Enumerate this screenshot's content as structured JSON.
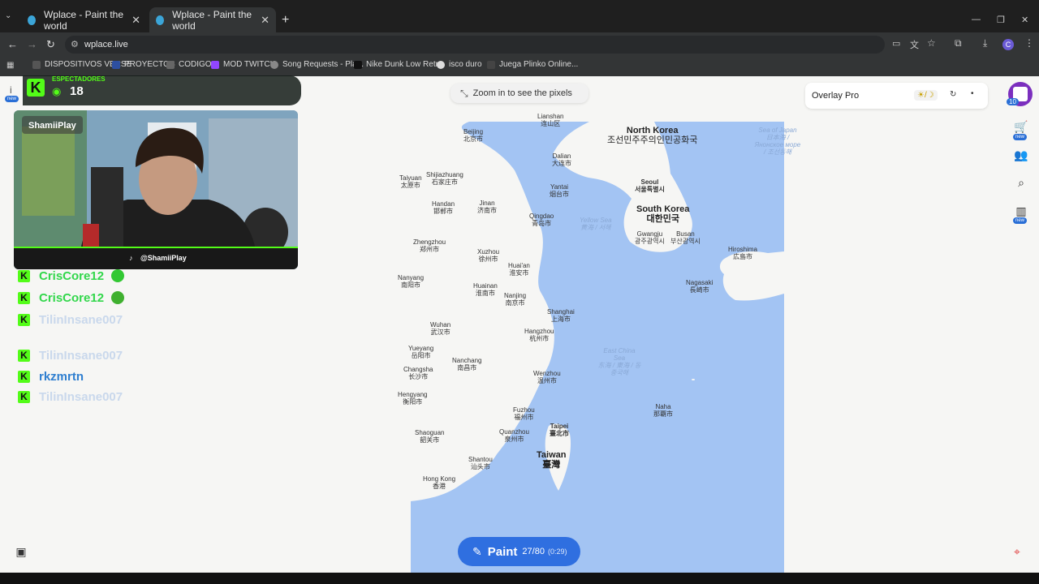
{
  "browser": {
    "tabs": [
      {
        "title": "Wplace - Paint the world"
      },
      {
        "title": "Wplace - Paint the world"
      }
    ],
    "new_tab": "+",
    "url": "wplace.live",
    "window_controls": {
      "minimize": "—",
      "maximize": "❐",
      "close": "✕"
    },
    "bookmarks": [
      "DISPOSITIVOS VERSE",
      "PROYECTOS",
      "CODIGO",
      "MOD TWITCH",
      "Song Requests - Pla...",
      "Nike Dunk Low Retr...",
      "isco duro",
      "Juega Plinko Online..."
    ]
  },
  "stream": {
    "viewers_label": "ESPECTADORES",
    "viewers_count": "18",
    "streamer_name": "ShamiiPlay",
    "tiktok_handle": "@ShamiiPlay",
    "chat": [
      {
        "name": "CrisCore12",
        "color": "#32d74b",
        "emote": true
      },
      {
        "name": "CrisCore12",
        "color": "#32d74b",
        "emote": true
      },
      {
        "name": "TilinInsane007",
        "color": "#c9d8ec",
        "emote": false
      },
      {
        "name": "TilinInsane007",
        "color": "#c9d8ec",
        "emote": false
      },
      {
        "name": "rkzmrtn",
        "color": "#2f7fd0",
        "emote": false
      },
      {
        "name": "TilinInsane007",
        "color": "#c9d8ec",
        "emote": false
      }
    ]
  },
  "wplace": {
    "zoom_hint": "Zoom in to see the pixels",
    "overlay_title": "Overlay Pro",
    "theme_toggle": "☀/☽",
    "paint_label": "Paint",
    "paint_count": "27/80",
    "paint_timer": "(0:29)",
    "avatar_level": "10",
    "new_badge": "new"
  },
  "map_labels": {
    "lianshan": "Lianshan",
    "lianshan_cn": "连山区",
    "beijing": "Beijing",
    "beijing_cn": "北京市",
    "north_korea": "North Korea",
    "north_korea_kr": "조선민주주의인민공화국",
    "sea_of_japan": "Sea of Japan",
    "sea_of_japan_jp": "日本海 / Янонское море / 조선동해",
    "dalian": "Dalian",
    "dalian_cn": "大连市",
    "taiyuan": "Taiyuan",
    "taiyuan_cn": "太原市",
    "shijiazhuang": "Shijiazhuang",
    "shijiazhuang_cn": "石家庄市",
    "yantai": "Yantai",
    "yantai_cn": "烟台市",
    "seoul": "Seoul",
    "seoul_kr": "서울특별시",
    "handan": "Handan",
    "handan_cn": "邯郸市",
    "jinan": "Jinan",
    "jinan_cn": "济南市",
    "qingdao": "Qingdao",
    "qingdao_cn": "青岛市",
    "yellow_sea": "Yellow Sea",
    "yellow_sea_cn": "黄海 / 서해",
    "south_korea": "South Korea",
    "south_korea_kr": "대한민국",
    "gwangju": "Gwangju",
    "gwangju_kr": "광주광역시",
    "busan": "Busan",
    "busan_kr": "부산광역시",
    "zhengzhou": "Zhengzhou",
    "zhengzhou_cn": "郑州市",
    "xuzhou": "Xuzhou",
    "xuzhou_cn": "徐州市",
    "hiroshima": "Hiroshima",
    "hiroshima_jp": "広島市",
    "huaian": "Huai'an",
    "huaian_cn": "淮安市",
    "nanyang": "Nanyang",
    "nanyang_cn": "南阳市",
    "huainan": "Huainan",
    "huainan_cn": "淮南市",
    "nagasaki": "Nagasaki",
    "nagasaki_jp": "長崎市",
    "nanjing": "Nanjing",
    "nanjing_cn": "南京市",
    "shanghai": "Shanghai",
    "shanghai_cn": "上海市",
    "wuhan": "Wuhan",
    "wuhan_cn": "武汉市",
    "hangzhou": "Hangzhou",
    "hangzhou_cn": "杭州市",
    "yueyang": "Yueyang",
    "yueyang_cn": "岳阳市",
    "east_china_sea": "East China Sea",
    "east_china_sea_cn": "东海 / 東海 / 동중국해",
    "nanchang": "Nanchang",
    "nanchang_cn": "南昌市",
    "changsha": "Changsha",
    "changsha_cn": "长沙市",
    "wenzhou": "Wenzhou",
    "wenzhou_cn": "温州市",
    "hengyang": "Hengyang",
    "hengyang_cn": "衡阳市",
    "naha": "Naha",
    "naha_jp": "那覇市",
    "fuzhou": "Fuzhou",
    "fuzhou_cn": "福州市",
    "taipei": "Taipei",
    "taipei_cn": "臺北市",
    "shaoguan": "Shaoguan",
    "shaoguan_cn": "韶关市",
    "quanzhou": "Quanzhou",
    "quanzhou_cn": "泉州市",
    "taiwan": "Taiwan",
    "taiwan_cn": "臺灣",
    "shantou": "Shantou",
    "shantou_cn": "汕头市",
    "hongkong": "Hong Kong",
    "hongkong_cn": "香港"
  },
  "colors": {
    "sea": "#a3c4f3",
    "land": "#f6f6f4",
    "paint_button": "#2f6fe0",
    "kick_green": "#53fc18"
  }
}
